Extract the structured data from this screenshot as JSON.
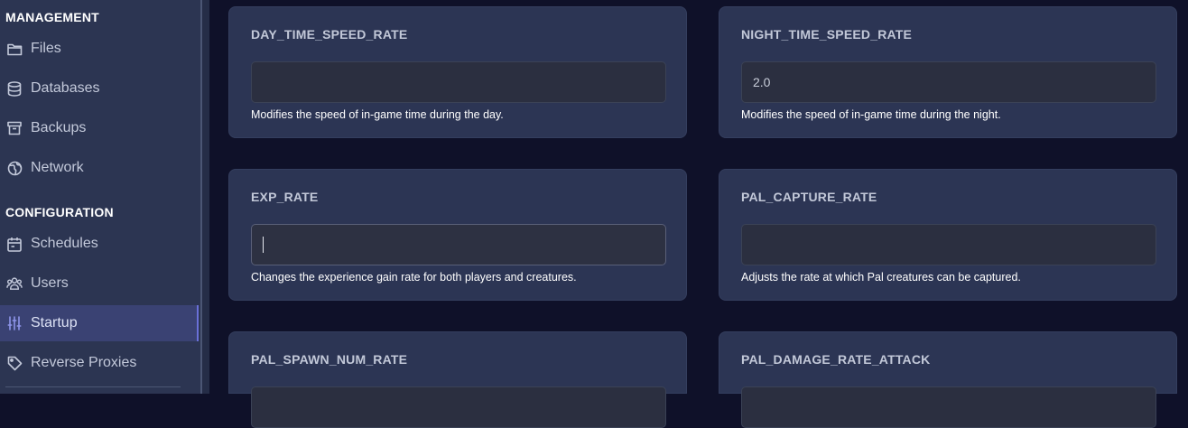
{
  "sidebar": {
    "sections": [
      {
        "heading": "MANAGEMENT"
      },
      {
        "heading": "CONFIGURATION"
      }
    ],
    "items": [
      {
        "label": "Files",
        "icon": "folder-icon"
      },
      {
        "label": "Databases",
        "icon": "database-icon"
      },
      {
        "label": "Backups",
        "icon": "archive-icon"
      },
      {
        "label": "Network",
        "icon": "globe-icon"
      },
      {
        "label": "Schedules",
        "icon": "calendar-icon"
      },
      {
        "label": "Users",
        "icon": "users-icon"
      },
      {
        "label": "Startup",
        "icon": "sliders-icon",
        "active": true
      },
      {
        "label": "Reverse Proxies",
        "icon": "tag-icon"
      }
    ]
  },
  "variables": [
    {
      "name": "DAY_TIME_SPEED_RATE",
      "value": "",
      "description": "Modifies the speed of in-game time during the day."
    },
    {
      "name": "NIGHT_TIME_SPEED_RATE",
      "value": "2.0",
      "description": "Modifies the speed of in-game time during the night."
    },
    {
      "name": "EXP_RATE",
      "value": "",
      "description": "Changes the experience gain rate for both players and creatures.",
      "focused": true
    },
    {
      "name": "PAL_CAPTURE_RATE",
      "value": "",
      "description": "Adjusts the rate at which Pal creatures can be captured."
    },
    {
      "name": "PAL_SPAWN_NUM_RATE",
      "value": "",
      "description": ""
    },
    {
      "name": "PAL_DAMAGE_RATE_ATTACK",
      "value": "",
      "description": ""
    }
  ],
  "colors": {
    "background": "#0f1129",
    "sidebar": "#2c3552",
    "card": "#2c3554",
    "active_accent": "#6a70d8"
  }
}
